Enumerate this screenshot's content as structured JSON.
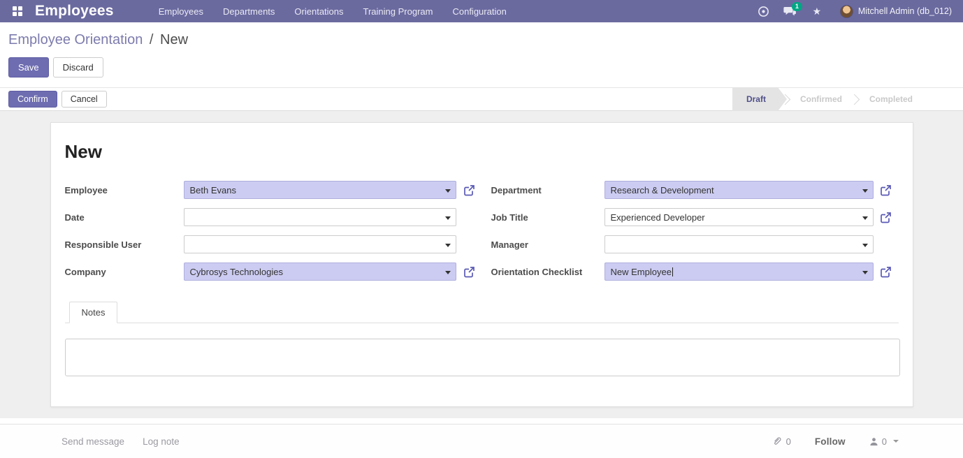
{
  "navbar": {
    "brand": "Employees",
    "menu": [
      {
        "label": "Employees"
      },
      {
        "label": "Departments"
      },
      {
        "label": "Orientations"
      },
      {
        "label": "Training Program"
      },
      {
        "label": "Configuration"
      }
    ],
    "systray": {
      "badge_count": "1",
      "user_name": "Mitchell Admin (db_012)"
    }
  },
  "breadcrumb": {
    "parent": "Employee Orientation",
    "separator": "/",
    "current": "New"
  },
  "actions": {
    "save": "Save",
    "discard": "Discard",
    "confirm": "Confirm",
    "cancel": "Cancel"
  },
  "statusbar": {
    "states": [
      {
        "label": "Draft",
        "active": true
      },
      {
        "label": "Confirmed",
        "active": false
      },
      {
        "label": "Completed",
        "active": false
      }
    ]
  },
  "form": {
    "title": "New",
    "fields": {
      "employee": {
        "label": "Employee",
        "value": "Beth Evans",
        "filled": true
      },
      "date": {
        "label": "Date",
        "value": "",
        "filled": false
      },
      "responsible_user": {
        "label": "Responsible User",
        "value": "",
        "filled": false
      },
      "company": {
        "label": "Company",
        "value": "Cybrosys Technologies",
        "filled": true
      },
      "department": {
        "label": "Department",
        "value": "Research & Development",
        "filled": true
      },
      "job_title": {
        "label": "Job Title",
        "value": "Experienced Developer",
        "filled": false
      },
      "manager": {
        "label": "Manager",
        "value": "",
        "filled": false
      },
      "orientation_checklist": {
        "label": "Orientation Checklist",
        "value": "New Employee",
        "filled": true
      }
    },
    "tabs": [
      {
        "label": "Notes",
        "active": true
      }
    ],
    "notes_value": ""
  },
  "chatter": {
    "send_message": "Send message",
    "log_note": "Log note",
    "attachment_count": "0",
    "follow_label": "Follow",
    "follower_count": "0"
  },
  "icons": {
    "apps-grid-icon": "2x2 white squares",
    "activity-clock-icon": "circle with center dot",
    "chat-bubble-icon": "speech bubbles with green badge",
    "star-icon": "★",
    "external-link-icon": "box with outgoing arrow",
    "dropdown-caret-icon": "▾",
    "paperclip-icon": "paperclip",
    "person-icon": "person silhouette",
    "caret-down-icon": "▾"
  },
  "colors": {
    "navbar_bg": "#6b6a9f",
    "primary_button": "#6e6db1",
    "link_purple": "#7c7bad",
    "filled_field_bg": "#ccccf2",
    "badge_green": "#00a784",
    "content_bg": "#efefef",
    "active_state_text": "#50508a"
  }
}
